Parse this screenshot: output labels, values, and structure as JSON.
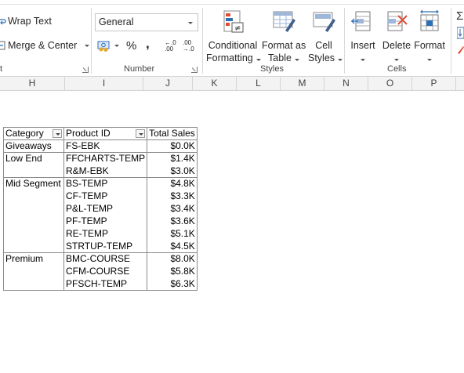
{
  "ribbon": {
    "alignment": {
      "wrap_text": "Wrap Text",
      "merge_center": "Merge & Center",
      "group_label_fragment": "t"
    },
    "number": {
      "format_value": "General",
      "percent": "%",
      "comma": ",",
      "increase_decimal_top": "←.0",
      "increase_decimal_bottom": ".00",
      "decrease_decimal_top": ".00",
      "decrease_decimal_bottom": "→.0",
      "group_label": "Number"
    },
    "styles": {
      "conditional_formatting_line1": "Conditional",
      "conditional_formatting_line2": "Formatting",
      "format_as_table_line1": "Format as",
      "format_as_table_line2": "Table",
      "cell_styles_line1": "Cell",
      "cell_styles_line2": "Styles",
      "group_label": "Styles"
    },
    "cells": {
      "insert": "Insert",
      "delete": "Delete",
      "format": "Format",
      "group_label": "Cells"
    }
  },
  "columns": [
    "H",
    "I",
    "J",
    "K",
    "L",
    "M",
    "N",
    "O",
    "P"
  ],
  "pivot": {
    "headers": {
      "category": "Category",
      "product_id": "Product ID",
      "total_sales": "Total Sales"
    },
    "groups": [
      {
        "category": "Giveaways",
        "rows": [
          {
            "product_id": "FS-EBK",
            "total_sales": "$0.0K"
          }
        ]
      },
      {
        "category": "Low End",
        "rows": [
          {
            "product_id": "FFCHARTS-TEMP",
            "total_sales": "$1.4K"
          },
          {
            "product_id": "R&M-EBK",
            "total_sales": "$3.0K"
          }
        ]
      },
      {
        "category": "Mid Segment",
        "rows": [
          {
            "product_id": "BS-TEMP",
            "total_sales": "$4.8K"
          },
          {
            "product_id": "CF-TEMP",
            "total_sales": "$3.3K"
          },
          {
            "product_id": "P&L-TEMP",
            "total_sales": "$3.4K"
          },
          {
            "product_id": "PF-TEMP",
            "total_sales": "$3.6K"
          },
          {
            "product_id": "RE-TEMP",
            "total_sales": "$5.1K"
          },
          {
            "product_id": "STRTUP-TEMP",
            "total_sales": "$4.5K"
          }
        ]
      },
      {
        "category": "Premium",
        "rows": [
          {
            "product_id": "BMC-COURSE",
            "total_sales": "$8.0K"
          },
          {
            "product_id": "CFM-COURSE",
            "total_sales": "$5.8K"
          },
          {
            "product_id": "PFSCH-TEMP",
            "total_sales": "$6.3K"
          }
        ]
      }
    ]
  },
  "colors": {
    "accent_red": "#e24a33",
    "accent_blue": "#2f6fb5",
    "grid_border": "#d4d4d4"
  }
}
